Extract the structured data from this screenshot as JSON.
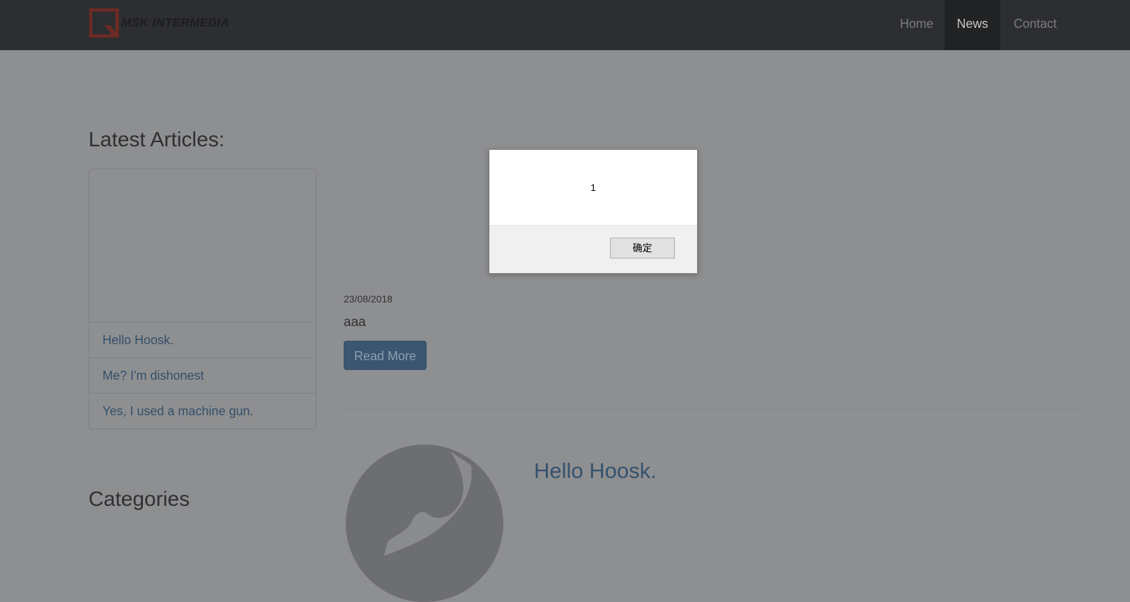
{
  "navbar": {
    "logo_text": "MSK INTERMEDIA",
    "items": [
      {
        "label": "Home",
        "active": false
      },
      {
        "label": "News",
        "active": true
      },
      {
        "label": "Contact",
        "active": false
      }
    ]
  },
  "sidebar": {
    "title": "Latest Articles:",
    "articles": [
      {
        "label": "Hello Hoosk."
      },
      {
        "label": "Me? I'm dishonest"
      },
      {
        "label": "Yes, I used a machine gun."
      }
    ],
    "categories_title": "Categories"
  },
  "main": {
    "article1": {
      "date": "23/08/2018",
      "excerpt": "aaa",
      "read_more": "Read More"
    },
    "article2": {
      "title": "Hello Hoosk."
    }
  },
  "dialog": {
    "message": "1",
    "ok_label": "确定"
  },
  "colors": {
    "navbar_bg": "#2d2e30",
    "logo_red": "#c0392b",
    "link": "#337ab7",
    "button_primary": "#337ab7",
    "overlay": "rgba(0,0,0,0.45)"
  }
}
